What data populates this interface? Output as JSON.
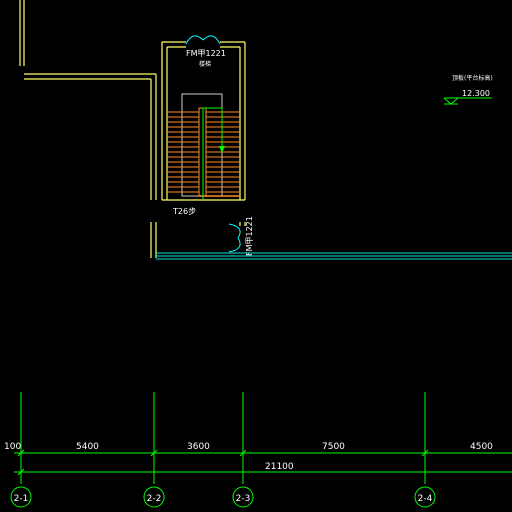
{
  "colors": {
    "background": "#000000",
    "wall": "#ffff66",
    "stair": "#ff8c28",
    "axis_line": "#00ff00",
    "door": "#00ffff",
    "cyan_line": "#00e0e0",
    "text": "#ffffff",
    "indicator": "#00ff00"
  },
  "stair": {
    "door_tag_top": "FM甲1221",
    "stair_label": "楼梯",
    "step_count_label": "T26步",
    "door_tag_side": "FM甲1221"
  },
  "elevation": {
    "label": "顶板(平台标高)",
    "value": "12.300"
  },
  "dimensions": {
    "segments": [
      "5400",
      "3600",
      "7500",
      "4500"
    ],
    "total": "21100",
    "edge": "100"
  },
  "axes": [
    "2-1",
    "2-2",
    "2-3",
    "2-4"
  ]
}
